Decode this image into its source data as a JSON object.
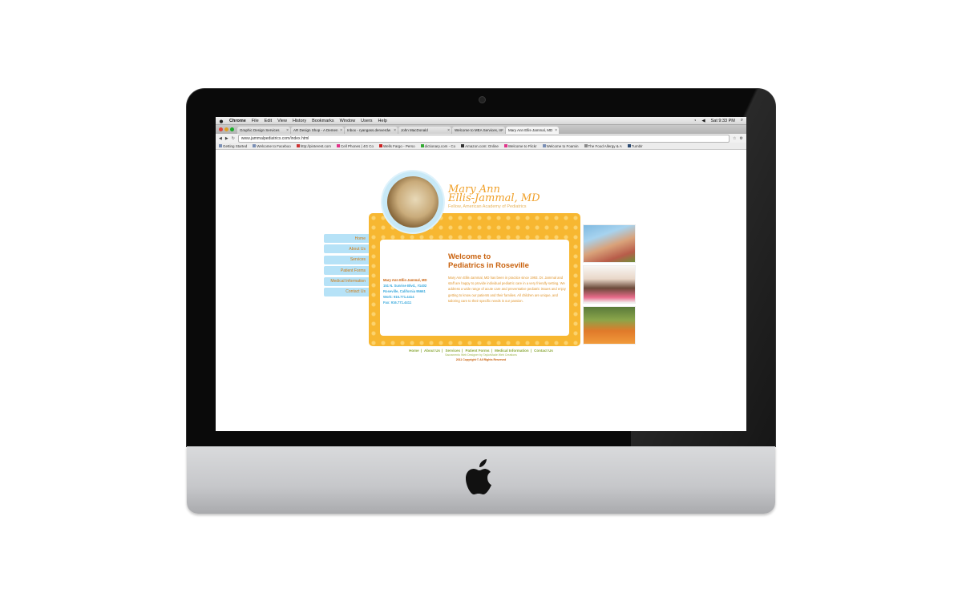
{
  "menubar": {
    "items": [
      "Chrome",
      "File",
      "Edit",
      "View",
      "History",
      "Bookmarks",
      "Window",
      "Users",
      "Help"
    ],
    "clock": "Sat 9:33 PM"
  },
  "tabs": [
    {
      "label": "Graphic Design Services"
    },
    {
      "label": "AR Design Shop - A Demen"
    },
    {
      "label": "Inbox - ryangass.denverdw"
    },
    {
      "label": "John MacDonald"
    },
    {
      "label": "Welcome to MEA Services, In"
    },
    {
      "label": "Mary Ann Ellis-Jammal, MD"
    }
  ],
  "address": {
    "url": "www.jammalpediatrics.com/index.html"
  },
  "bookmarks": [
    "Getting Started",
    "Welcome to Faceboo",
    "http://pinterest.com",
    "Cell Phones | 4G Co",
    "Wells Fargo - Perso",
    "dictionary.com - Co",
    "Amazon.com: Online",
    "Welcome to Flickr",
    "Welcome to Foamin",
    "The Food Allergy & A",
    "Tumblr"
  ],
  "site": {
    "title_line1": "Mary Ann",
    "title_line2": "Ellis-Jammal, MD",
    "subtitle": "Fellow, American Academy of Pediatrics",
    "nav": [
      "Home",
      "About Us",
      "Services",
      "Patient Forms",
      "Medical Information",
      "Contact Us"
    ],
    "welcome_line1": "Welcome to",
    "welcome_line2": "Pediatrics in Roseville",
    "contact": {
      "name": "Mary Ann Ellis-Jammal, MD",
      "street": "151 N. Sunrise Blvd., #1402",
      "city": "Roseville, California  95661",
      "work": "Work: 916.771.4414",
      "fax": "Fax: 916.771.4411"
    },
    "intro": "Mary Ann Ellis-Jammal, MD has been in practice since 1993. Dr. Jammal and staff are happy to provide individual pediatric care in a very friendly setting. We address a wide range of acute care and preventative pediatric issues and enjoy getting to know our patients and their families. All children are unique, and tailoring care to their specific needs is our passion.",
    "footer_links": [
      "Home",
      "About Us",
      "Services",
      "Patient Forms",
      "Medical Information",
      "Contact Us"
    ],
    "footer_credit": "Sacramento Web Designer by TaylorMade Web Creations",
    "footer_copy": "2011 Copyright © All Rights Reserved"
  },
  "colors": {
    "accent_orange": "#f7b731",
    "nav_blue": "#b6e2f7",
    "title_orange": "#f0a12b"
  }
}
